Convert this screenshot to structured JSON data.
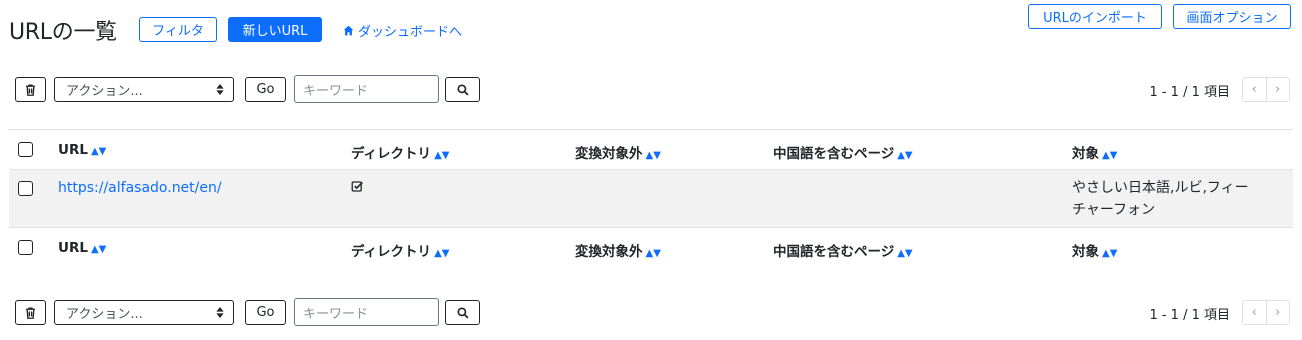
{
  "page_title": "URLの一覧",
  "buttons": {
    "filter": "フィルタ",
    "new_url": "新しいURL",
    "dashboard": "ダッシュボードへ",
    "import": "URLのインポート",
    "screen_options": "画面オプション"
  },
  "toolbar": {
    "action_select": "アクション...",
    "go": "Go",
    "keyword_placeholder": "キーワード",
    "pager_text": "1 - 1 / 1 項目",
    "prev": "‹",
    "next": "›"
  },
  "table": {
    "columns": [
      {
        "label": "URL",
        "sort": "▲▼"
      },
      {
        "label": "ディレクトリ",
        "sort": "▲▼"
      },
      {
        "label": "変換対象外",
        "sort": "▲▼"
      },
      {
        "label": "中国語を含むページ",
        "sort": "▲▼"
      },
      {
        "label": "対象",
        "sort": "▲▼"
      }
    ],
    "rows": [
      {
        "url": "https://alfasado.net/en/",
        "directory_checked": true,
        "excluded": "",
        "chinese_page": "",
        "target_line1": "やさしい日本語,ルビ,フィー",
        "target_line2": "チャーフォン"
      }
    ]
  },
  "icons": {
    "trash": "trash-icon",
    "search": "search-icon",
    "home": "home-icon",
    "select_arrows": "select-arrows-icon",
    "check": "checked-box-icon"
  },
  "colors": {
    "accent": "#0d6efd",
    "row_bg": "#f2f2f2"
  }
}
